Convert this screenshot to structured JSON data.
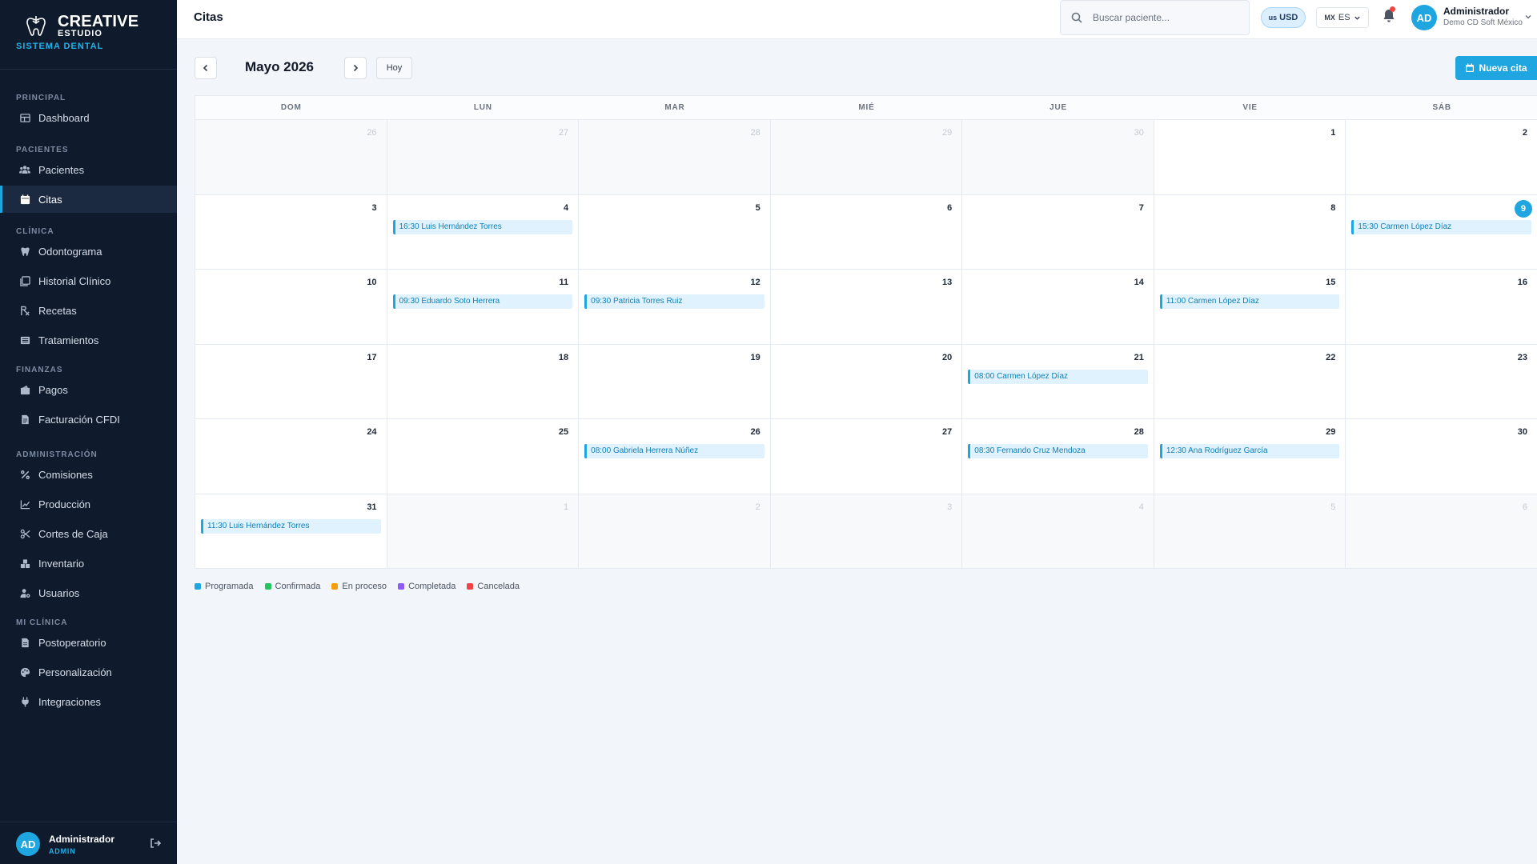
{
  "brand": {
    "name": "CREATIVE",
    "sub": "ESTUDIO",
    "tag": "SISTEMA DENTAL"
  },
  "nav": [
    {
      "section": "PRINCIPAL",
      "items": [
        {
          "label": "Dashboard",
          "icon": "dashboard-icon"
        }
      ]
    },
    {
      "section": "PACIENTES",
      "items": [
        {
          "label": "Pacientes",
          "icon": "users-icon"
        },
        {
          "label": "Citas",
          "icon": "calendar-icon",
          "active": true
        }
      ]
    },
    {
      "section": "CLÍNICA",
      "items": [
        {
          "label": "Odontograma",
          "icon": "tooth-icon"
        },
        {
          "label": "Historial Clínico",
          "icon": "history-icon"
        },
        {
          "label": "Recetas",
          "icon": "prescription-icon"
        },
        {
          "label": "Tratamientos",
          "icon": "list-icon"
        }
      ]
    },
    {
      "section": "FINANZAS",
      "items": [
        {
          "label": "Pagos",
          "icon": "wallet-icon"
        },
        {
          "label": "Facturación CFDI",
          "icon": "invoice-icon"
        }
      ]
    },
    {
      "section": "ADMINISTRACIÓN",
      "items": [
        {
          "label": "Comisiones",
          "icon": "percent-icon"
        },
        {
          "label": "Producción",
          "icon": "chart-line-icon"
        },
        {
          "label": "Cortes de Caja",
          "icon": "scissors-icon"
        },
        {
          "label": "Inventario",
          "icon": "boxes-icon"
        },
        {
          "label": "Usuarios",
          "icon": "user-cog-icon"
        }
      ]
    },
    {
      "section": "MI CLÍNICA",
      "items": [
        {
          "label": "Postoperatorio",
          "icon": "document-icon"
        },
        {
          "label": "Personalización",
          "icon": "palette-icon"
        },
        {
          "label": "Integraciones",
          "icon": "plug-icon"
        }
      ]
    }
  ],
  "sidebar_footer": {
    "avatar": "AD",
    "name": "Administrador",
    "role": "ADMIN"
  },
  "header": {
    "title": "Citas",
    "search_placeholder": "Buscar paciente...",
    "currency_flag": "us",
    "currency": "USD",
    "lang_flag": "MX",
    "lang": "ES",
    "avatar": "AD",
    "user": "Administrador",
    "org": "Demo CD Soft México"
  },
  "toolbar": {
    "month": "Mayo 2026",
    "today_label": "Hoy",
    "new_label": "Nueva cita"
  },
  "calendar": {
    "weekdays": [
      "DOM",
      "LUN",
      "MAR",
      "MIÉ",
      "JUE",
      "VIE",
      "SÁB"
    ],
    "today": "9",
    "weeks": [
      [
        {
          "d": "26",
          "o": true
        },
        {
          "d": "27",
          "o": true
        },
        {
          "d": "28",
          "o": true
        },
        {
          "d": "29",
          "o": true
        },
        {
          "d": "30",
          "o": true
        },
        {
          "d": "1"
        },
        {
          "d": "2"
        }
      ],
      [
        {
          "d": "3"
        },
        {
          "d": "4",
          "e": [
            "16:30 Luis Hernández Torres"
          ]
        },
        {
          "d": "5"
        },
        {
          "d": "6"
        },
        {
          "d": "7"
        },
        {
          "d": "8"
        },
        {
          "d": "9",
          "e": [
            "15:30 Carmen López Díaz"
          ]
        }
      ],
      [
        {
          "d": "10"
        },
        {
          "d": "11",
          "e": [
            "09:30 Eduardo Soto Herrera"
          ]
        },
        {
          "d": "12",
          "e": [
            "09:30 Patricia Torres Ruiz"
          ]
        },
        {
          "d": "13"
        },
        {
          "d": "14"
        },
        {
          "d": "15",
          "e": [
            "11:00 Carmen López Díaz"
          ]
        },
        {
          "d": "16"
        }
      ],
      [
        {
          "d": "17"
        },
        {
          "d": "18"
        },
        {
          "d": "19"
        },
        {
          "d": "20"
        },
        {
          "d": "21",
          "e": [
            "08:00 Carmen López Díaz"
          ]
        },
        {
          "d": "22"
        },
        {
          "d": "23"
        }
      ],
      [
        {
          "d": "24"
        },
        {
          "d": "25"
        },
        {
          "d": "26",
          "e": [
            "08:00 Gabriela Herrera Núñez"
          ]
        },
        {
          "d": "27"
        },
        {
          "d": "28",
          "e": [
            "08:30 Fernando Cruz Mendoza"
          ]
        },
        {
          "d": "29",
          "e": [
            "12:30 Ana Rodríguez García"
          ]
        },
        {
          "d": "30"
        }
      ],
      [
        {
          "d": "31",
          "e": [
            "11:30 Luis Hernández Torres"
          ]
        },
        {
          "d": "1",
          "o": true
        },
        {
          "d": "2",
          "o": true
        },
        {
          "d": "3",
          "o": true
        },
        {
          "d": "4",
          "o": true
        },
        {
          "d": "5",
          "o": true
        },
        {
          "d": "6",
          "o": true
        }
      ]
    ]
  },
  "legend": [
    {
      "label": "Programada",
      "color": "#1fa6e0"
    },
    {
      "label": "Confirmada",
      "color": "#22c55e"
    },
    {
      "label": "En proceso",
      "color": "#f59e0b"
    },
    {
      "label": "Completada",
      "color": "#8b5cf6"
    },
    {
      "label": "Cancelada",
      "color": "#ef4444"
    }
  ]
}
